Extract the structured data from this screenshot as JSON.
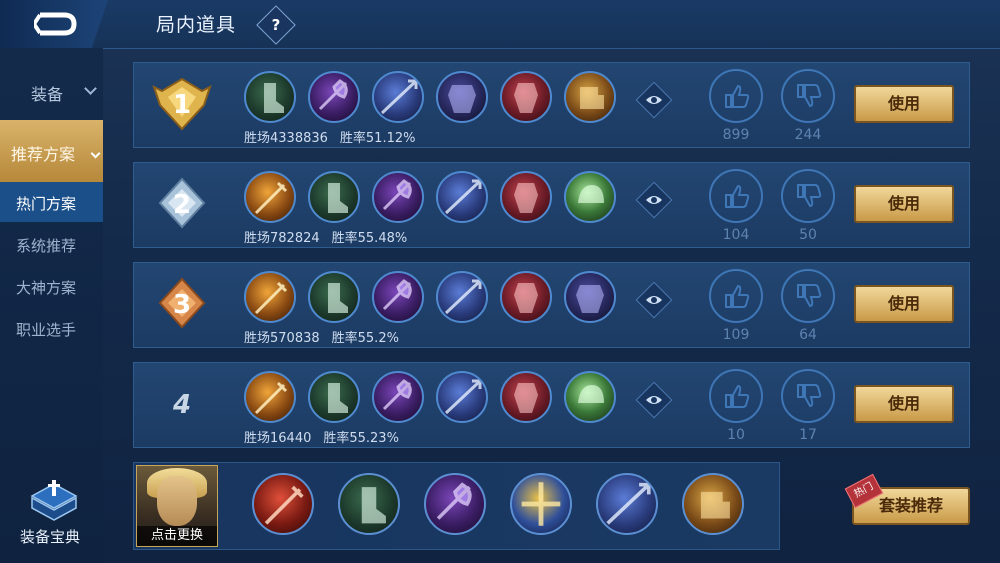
{
  "header": {
    "title": "局内道具",
    "help": "?"
  },
  "sidebar": {
    "category": "装备",
    "active": "推荐方案",
    "subitems": [
      {
        "label": "热门方案"
      },
      {
        "label": "系统推荐"
      },
      {
        "label": "大神方案"
      },
      {
        "label": "职业选手"
      }
    ],
    "guide_label": "装备宝典"
  },
  "rows": [
    {
      "rank": "1",
      "games_label": "胜场4338836",
      "winrate_label": "胜率51.12%",
      "likes": "899",
      "dislikes": "244",
      "use_label": "使用",
      "items": [
        "boots-green",
        "axe-purple",
        "spear-blue",
        "armor-purple",
        "armor-red",
        "gauntlet-gold"
      ]
    },
    {
      "rank": "2",
      "games_label": "胜场782824",
      "winrate_label": "胜率55.48%",
      "likes": "104",
      "dislikes": "50",
      "use_label": "使用",
      "items": [
        "sword-gold",
        "boots-green",
        "axe-purple",
        "spear-blue",
        "armor-red",
        "helm-green"
      ]
    },
    {
      "rank": "3",
      "games_label": "胜场570838",
      "winrate_label": "胜率55.2%",
      "likes": "109",
      "dislikes": "64",
      "use_label": "使用",
      "items": [
        "sword-gold",
        "boots-green",
        "axe-purple",
        "spear-blue",
        "armor-red",
        "armor-purple"
      ]
    },
    {
      "rank": "4",
      "games_label": "胜场16440",
      "winrate_label": "胜率55.23%",
      "likes": "10",
      "dislikes": "17",
      "use_label": "使用",
      "items": [
        "sword-gold",
        "boots-green",
        "axe-purple",
        "spear-blue",
        "armor-red",
        "helm-green"
      ]
    }
  ],
  "bottom": {
    "hero_label": "点击更换",
    "items": [
      "sword-red",
      "boots-green",
      "axe-purple",
      "cross-gold",
      "spear-blue",
      "gauntlet-gold"
    ],
    "hot_tag": "热门",
    "suit_label": "套装推荐"
  },
  "colors": {
    "accent_gold": "#d9b36a",
    "panel": "#224672",
    "vote_ring": "#3f77b6"
  }
}
